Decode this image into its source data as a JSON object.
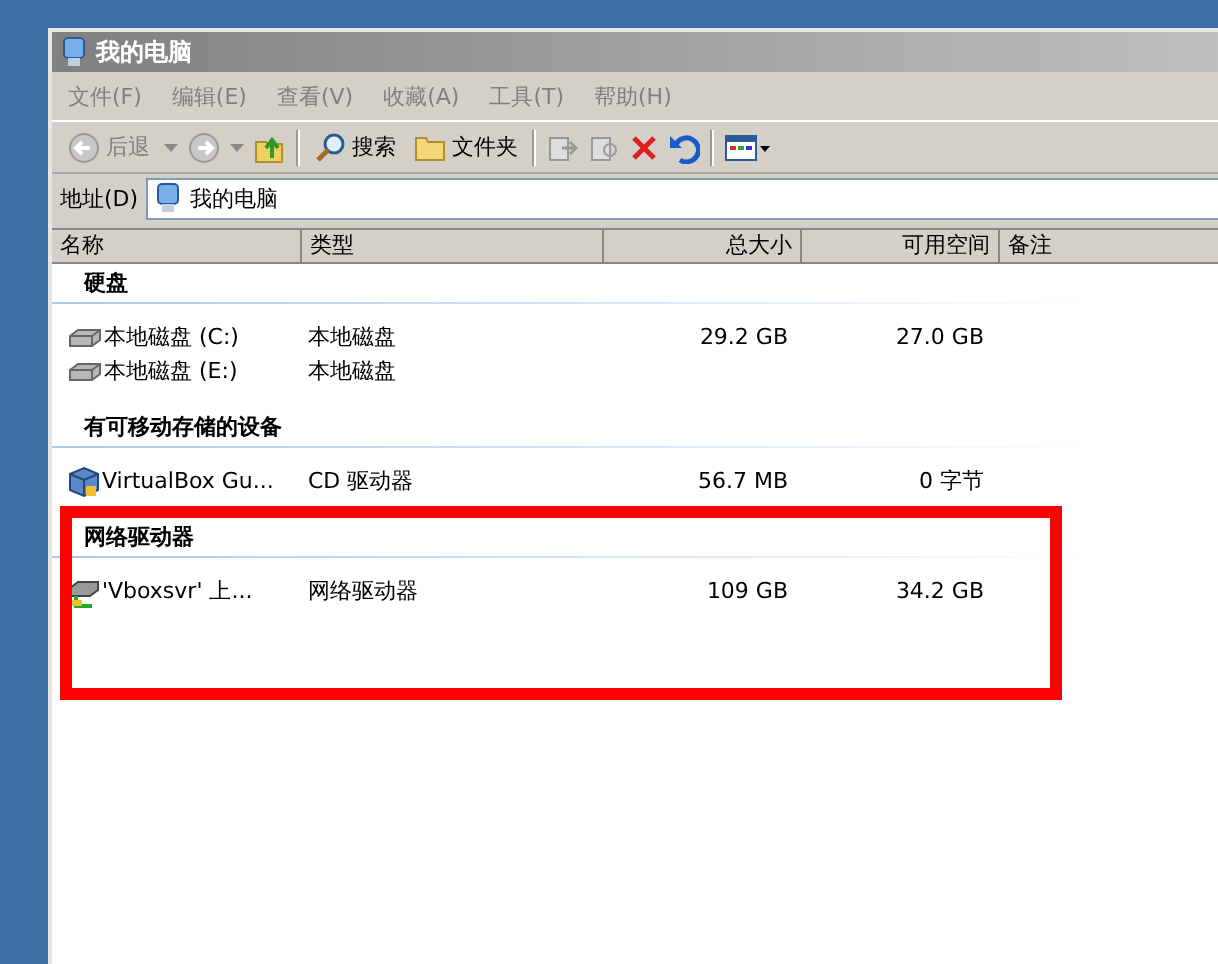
{
  "window": {
    "title": "我的电脑"
  },
  "menu": [
    "文件(F)",
    "编辑(E)",
    "查看(V)",
    "收藏(A)",
    "工具(T)",
    "帮助(H)"
  ],
  "toolbar": {
    "back": "后退",
    "search": "搜索",
    "folders": "文件夹"
  },
  "address": {
    "label": "地址(D)",
    "value": "我的电脑"
  },
  "columns": [
    "名称",
    "类型",
    "总大小",
    "可用空间",
    "备注"
  ],
  "groups": [
    {
      "title": "硬盘",
      "highlighted": false,
      "items": [
        {
          "kind": "disk",
          "name": "本地磁盘 (C:)",
          "type": "本地磁盘",
          "total": "29.2 GB",
          "free": "27.0 GB"
        },
        {
          "kind": "disk",
          "name": "本地磁盘 (E:)",
          "type": "本地磁盘"
        }
      ]
    },
    {
      "title": "有可移动存储的设备",
      "highlighted": false,
      "items": [
        {
          "kind": "cd",
          "name": "VirtualBox Gu...",
          "type": "CD 驱动器",
          "total": "56.7 MB",
          "free": "0 字节"
        }
      ]
    },
    {
      "title": "网络驱动器",
      "highlighted": true,
      "items": [
        {
          "kind": "network",
          "name": "'Vboxsvr' 上...",
          "type": "网络驱动器",
          "total": "109 GB",
          "free": "34.2 GB"
        }
      ]
    }
  ]
}
